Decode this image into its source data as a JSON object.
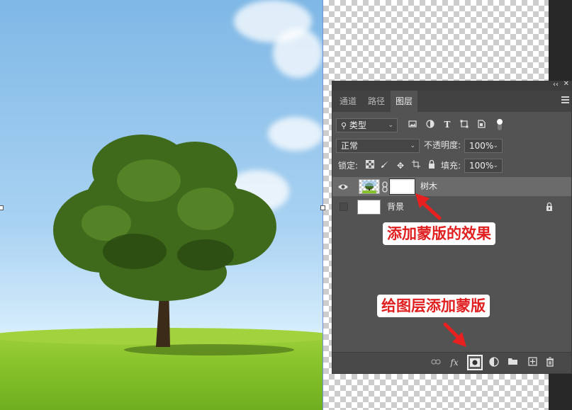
{
  "panel": {
    "tabs": [
      {
        "label": "通道",
        "active": false
      },
      {
        "label": "路径",
        "active": false
      },
      {
        "label": "图层",
        "active": true
      }
    ],
    "filter_kind": "类型",
    "blend_mode": "正常",
    "opacity_label": "不透明度:",
    "opacity_value": "100%",
    "lock_label": "锁定:",
    "fill_label": "填充:",
    "fill_value": "100%",
    "layers": [
      {
        "name": "树木",
        "visible": true,
        "has_mask": true,
        "selected": true
      },
      {
        "name": "背景",
        "visible": false,
        "locked": true,
        "selected": false
      }
    ],
    "bottom_icons": [
      "link-icon",
      "fx-icon",
      "add-mask-icon",
      "adjustment-icon",
      "folder-icon",
      "new-layer-icon",
      "trash-icon"
    ],
    "fx_label": "fx"
  },
  "annotations": {
    "mask_effect": "添加蒙版的效果",
    "add_mask": "给图层添加蒙版"
  },
  "colors": {
    "callout_text": "#e02020",
    "arrow": "#e82020",
    "panel_bg": "#535353",
    "selected_row": "#6b6b6b"
  }
}
